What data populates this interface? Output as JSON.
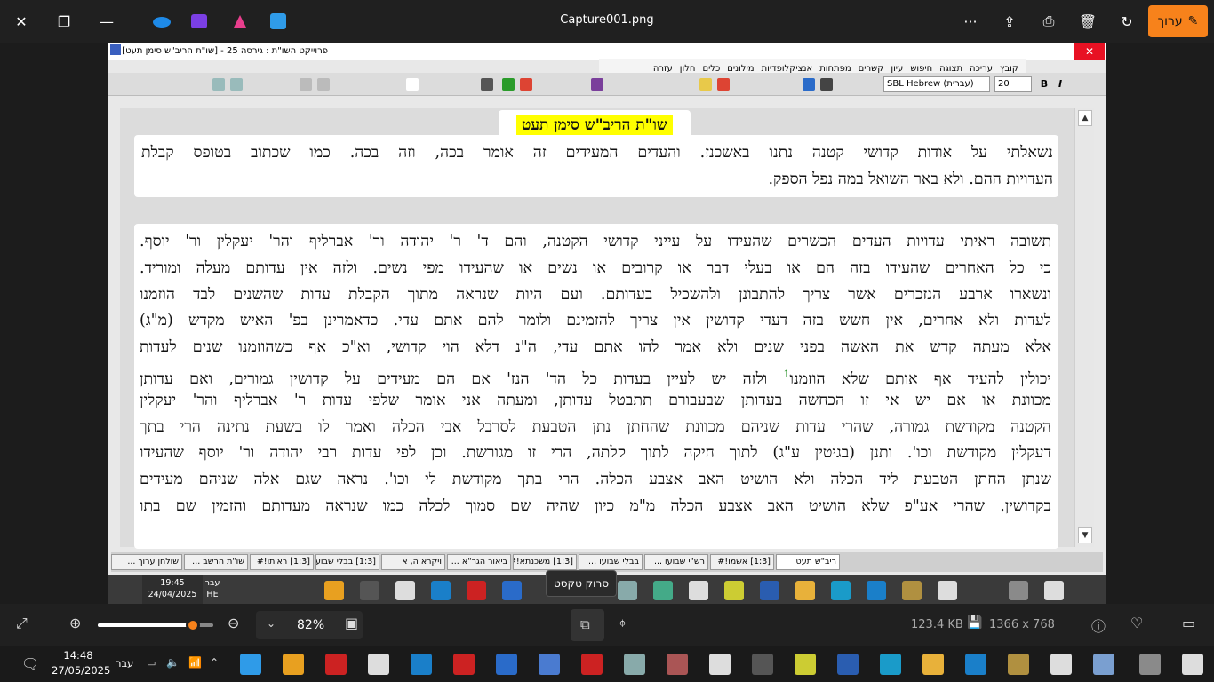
{
  "viewer": {
    "title": "Capture001.png",
    "edit_label": "ערוך",
    "file_size": "123.4 KB",
    "dimensions": "1366 x 768",
    "zoom": "82%",
    "zoom_fraction": 0.82,
    "tooltip": "סרוק טקסט"
  },
  "inner_window": {
    "title": "פרוייקט השו\"ת : גירסה 25  - [שו\"ת הריב\"ש סימן תעט]",
    "menu": [
      "קובץ",
      "עריכה",
      "תצוגה",
      "חיפוש",
      "עיון",
      "קשרים",
      "מפתחות",
      "אנציקלופדיות",
      "מילונים",
      "כלים",
      "חלון",
      "עזרה"
    ],
    "font": "SBL Hebrew (עברית)",
    "font_size": "20",
    "bold": "B",
    "italic": "I"
  },
  "document": {
    "title": "שו\"ת הריב\"ש סימן תעט",
    "question_lines": [
      "נשאלתי על אודות קדושי קטנה נתנו באשכנז. והעדים המעידים זה אומר בכה, וזה בכה. כמו שכתוב בטופס קבלת",
      "העדויות ההם. ולא באר השואל במה נפל הספק."
    ],
    "answer_lines": [
      "תשובה ראיתי עדויות העדים הכשרים שהעידו על עייני קדושי הקטנה, והם ד' ר' יהודה ור' אברליף והר' יעקלין ור' יוסף.",
      "כי כל האחרים שהעידו בזה הם או בעלי דבר או קרובים או נשים או שהעידו מפי נשים. ולזה אין עדותם מעלה ומוריד.",
      "ונשארו ארבע הנזכרים אשר צריך להתבונן ולהשכיל בעדותם. ועם היות שנראה מתוך הקבלת עדות שהשנים לבד הוזמנו",
      "לעדות ולא אחרים, אין חשש בזה דעדי קדושין אין צריך להזמינם ולומר להם אתם עדי. כדאמרינן בפ' האיש מקדש (מ\"ג)",
      "אלא מעתה קדש את האשה בפני שנים ולא אמר להו אתם עדי, ה\"נ דלא הוי קדושי, וא\"כ אף כשהוזמנו שנים לעדות",
      "יכולין להעיד אף אותם שלא הוזמנו",
      "מכוונת או אם יש אי זו הכחשה בעדותן שבעבורם תתבטל עדותן, ומעתה אני אומר שלפי עדות ר' אברליף והר' יעקלין",
      "הקטנה מקודשת גמורה, שהרי עדות שניהם מכוונת שהחתן נתן הטבעת לסרבל אבי הכלה ואמר לו בשעת נתינה הרי בתך",
      "דעקלין מקודשת וכו'. ותנן (בגיטין ע\"ג) לתוך חיקה לתוך קלתה, הרי זו מגורשת. וכן לפי עדות רבי יהודה ור' יוסף שהעידו",
      "שנתן החתן הטבעת ליד הכלה ולא הושיט האב אצבע הכלה. הרי בתך מקודשת לי וכו'. נראה שגם אלה שניהם מעידים",
      "בקדושין. שהרי אע\"פ שלא הושיט האב אצבע הכלה מ\"מ כיון שהיה שם סמוך לכלה כמו שנראה מעדותם והזמין שם בתו"
    ],
    "answer_line6_rest": "ולזה יש לעיין בעדות כל הד' הנז' אם הם מעידים על קדושין גמורים, ואם עדותן",
    "footnote_mark": "1"
  },
  "tabs": [
    "שולחן ערוך ...",
    "שו\"ת הרשב ...",
    "[1:3] ראיתו!#",
    "[1:3] בבלי שבועו ...",
    "ויקרא ה, א",
    "ביאור הגר\"א ...",
    "[1:3] משכנתא!#",
    "בבלי שבועו ...",
    "רש\"י שבועו ...",
    "[1:3] אשמו!#",
    "ריב\"ש תעט"
  ],
  "inner_taskbar": {
    "time": "19:45",
    "date": "24/04/2025",
    "lang_top": "עבר",
    "lang_bottom": "HE"
  },
  "taskbar": {
    "time": "14:48",
    "date": "27/05/2025",
    "lang": "עבר"
  },
  "colors": {
    "accent": "#f7821b",
    "title_highlight": "#ffff00",
    "footnote": "#1a8a1a"
  }
}
